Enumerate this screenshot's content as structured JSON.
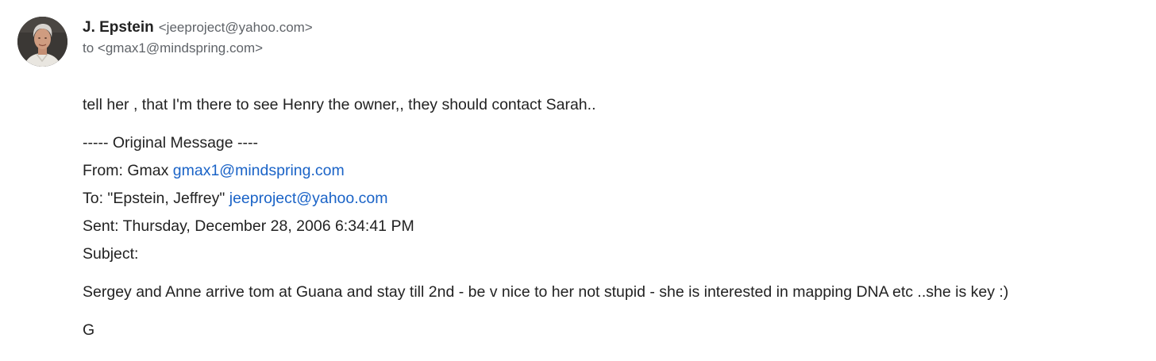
{
  "sender": {
    "name": "J. Epstein",
    "email": "<jeeproject@yahoo.com>",
    "to": "to <gmax1@mindspring.com>"
  },
  "message": {
    "reply": "tell her , that I'm there to see Henry the owner,, they should contact Sarah..",
    "original_header": "----- Original Message ----",
    "from_label": "From: Gmax",
    "from_email": "gmax1@mindspring.com",
    "to_label": "To: \"Epstein, Jeffrey\"",
    "to_email": "jeeproject@yahoo.com",
    "sent": "Sent: Thursday, December 28, 2006 6:34:41 PM",
    "subject": "Subject:",
    "body": "Sergey and Anne arrive tom at Guana and stay till 2nd - be v nice to her not stupid - she is interested in mapping DNA etc ..she is key :)",
    "signature": "G"
  }
}
